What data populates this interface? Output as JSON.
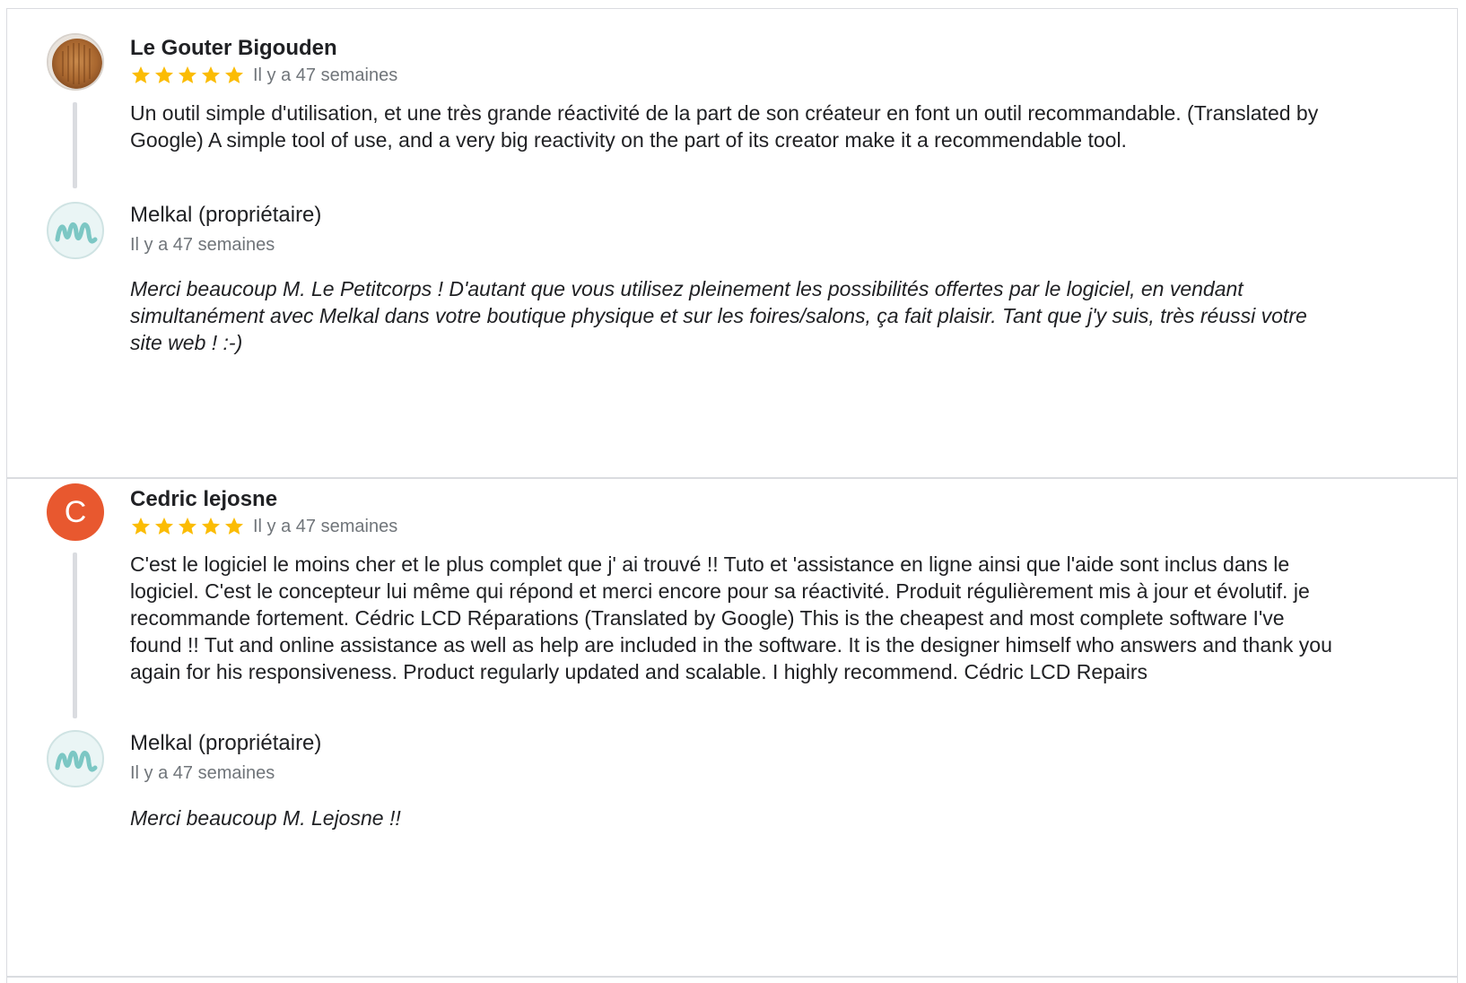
{
  "reviews": [
    {
      "author": "Le Gouter Bigouden",
      "avatar_type": "photo",
      "rating": 5,
      "time": "Il y a 47 semaines",
      "text": "Un outil simple d'utilisation, et une très grande réactivité de la part de son créateur en font un outil recommandable. (Translated by Google) A simple tool of use, and a very big reactivity on the part of its creator make it a recommendable tool.",
      "reply": {
        "author": "Melkal (propriétaire)",
        "time": "Il y a 47 semaines",
        "text": "Merci beaucoup M. Le Petitcorps ! D'autant que vous utilisez pleinement les possibilités offertes par le logiciel, en vendant simultanément avec Melkal dans votre boutique physique et sur les foires/salons, ça fait plaisir. Tant que j'y suis, très réussi votre site web ! :-)"
      }
    },
    {
      "author": "Cedric lejosne",
      "avatar_letter": "C",
      "avatar_color": "#e8582f",
      "rating": 5,
      "time": "Il y a 47 semaines",
      "text": "C'est le logiciel le moins cher et le plus complet que j' ai trouvé !! Tuto et 'assistance en ligne ainsi que l'aide sont inclus dans le logiciel. C'est le concepteur lui même qui répond et merci encore pour sa réactivité. Produit régulièrement mis à jour et évolutif. je recommande fortement. Cédric LCD Réparations (Translated by Google) This is the cheapest and most complete software I've found !! Tut and online assistance as well as help are included in the software. It is the designer himself who answers and thank you again for his responsiveness. Product regularly updated and scalable. I highly recommend. Cédric LCD Repairs",
      "reply": {
        "author": "Melkal (propriétaire)",
        "time": "Il y a 47 semaines",
        "text": "Merci beaucoup M. Lejosne !!"
      }
    }
  ],
  "colors": {
    "star": "#fbbc04",
    "divider": "#dadce0",
    "owner_logo": "#7cc7c4"
  }
}
